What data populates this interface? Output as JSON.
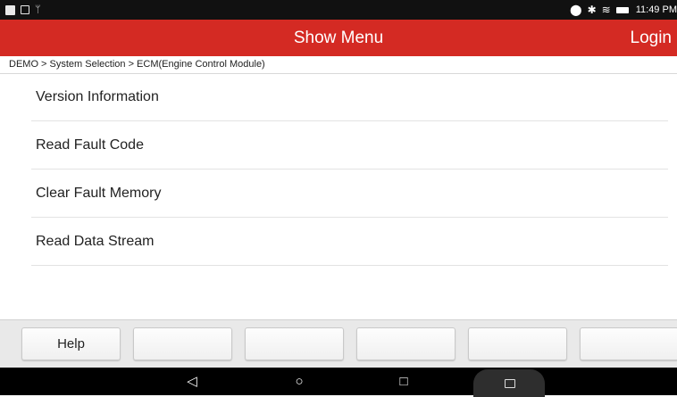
{
  "status_bar": {
    "left_icons": [
      "notification-image-icon",
      "notification-gallery-icon",
      "usb-icon"
    ],
    "right_icons": [
      "location-icon",
      "bluetooth-icon",
      "wifi-icon",
      "battery-icon"
    ],
    "time": "11:49 PM"
  },
  "header": {
    "title": "Show Menu",
    "login_label": "Login",
    "color": "#d42a23"
  },
  "breadcrumb": "DEMO > System Selection > ECM(Engine Control Module)",
  "menu": {
    "items": [
      {
        "label": "Version Information"
      },
      {
        "label": "Read Fault Code"
      },
      {
        "label": "Clear Fault Memory"
      },
      {
        "label": "Read Data Stream"
      }
    ]
  },
  "toolbar": {
    "buttons": [
      {
        "label": "Help"
      },
      {
        "label": ""
      },
      {
        "label": ""
      },
      {
        "label": ""
      },
      {
        "label": ""
      },
      {
        "label": ""
      }
    ]
  },
  "nav_bar": {
    "icons": [
      "back-icon",
      "home-icon",
      "recents-icon",
      "screens-icon"
    ]
  }
}
